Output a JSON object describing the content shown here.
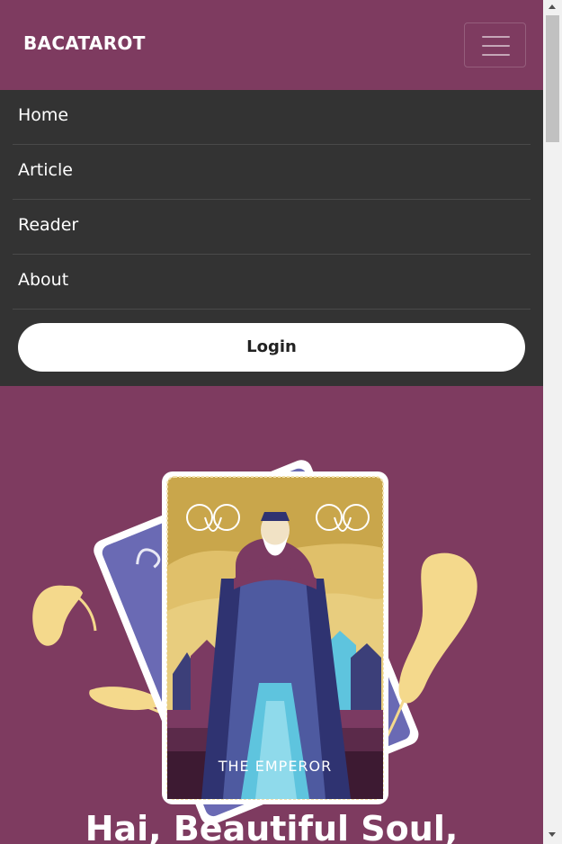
{
  "brand": "BACATAROT",
  "nav": {
    "items": [
      {
        "label": "Home"
      },
      {
        "label": "Article"
      },
      {
        "label": "Reader"
      },
      {
        "label": "About"
      }
    ],
    "login_label": "Login",
    "toggler_icon": "hamburger-icon"
  },
  "hero": {
    "card_caption": "THE EMPEROR",
    "title": "Hai, Beautiful Soul,"
  },
  "colors": {
    "primary": "#7e3b60",
    "menu_bg": "#333333",
    "card_gold": "#c9a64b",
    "card_back": "#6b6bb3",
    "leaf": "#f4d98c"
  }
}
